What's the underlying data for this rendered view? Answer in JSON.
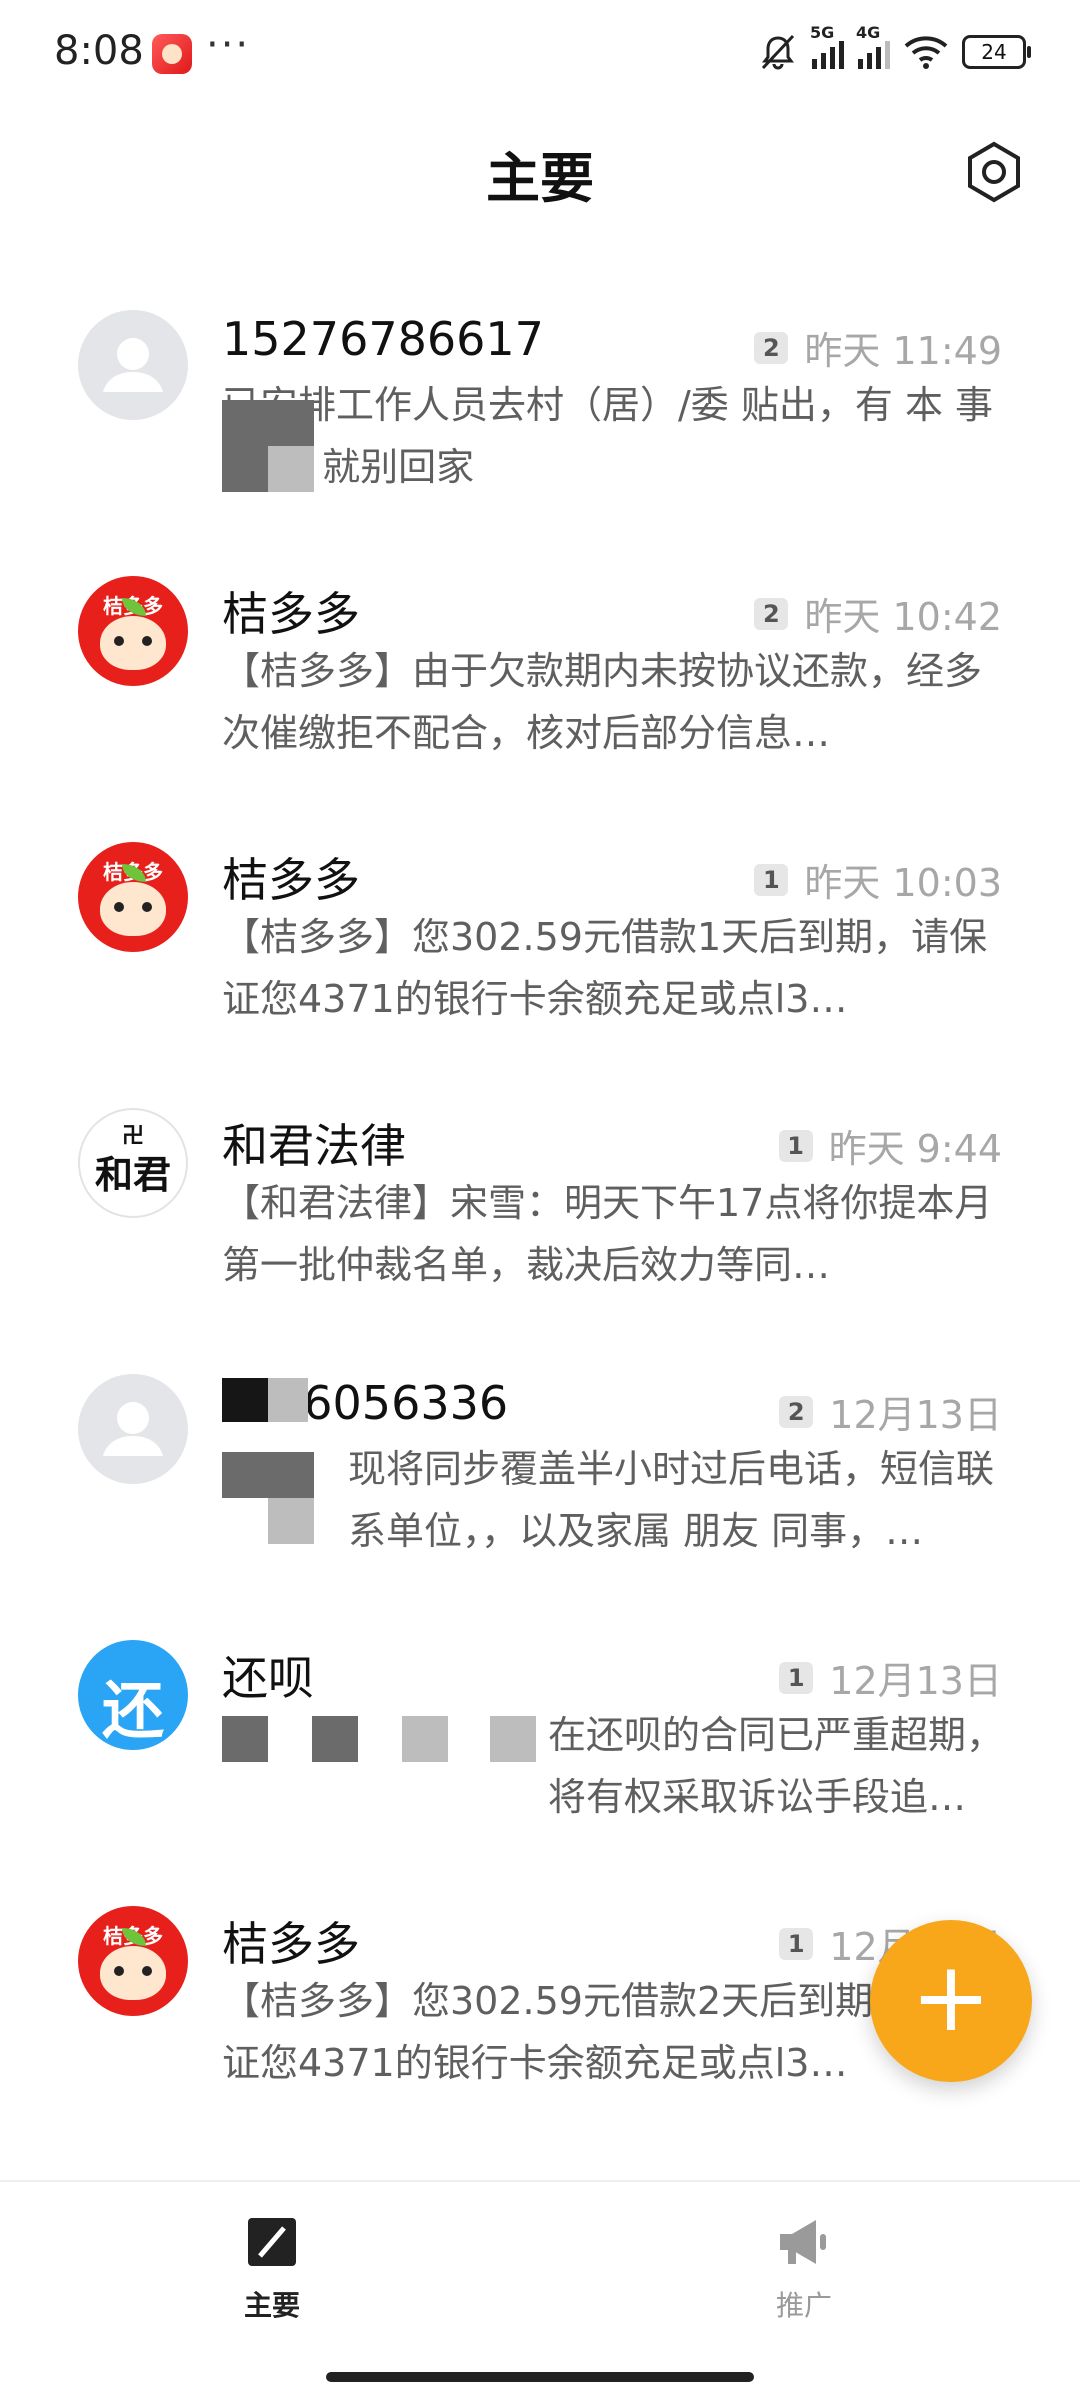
{
  "status_bar": {
    "time": "8:08",
    "dots": "···",
    "net1": "5G",
    "net2": "4G",
    "battery": "24"
  },
  "header": {
    "title": "主要"
  },
  "conversations": [
    {
      "name": "15276786617",
      "badge": "2",
      "time": "昨天 11:49",
      "preview": "已安排工作人员去村（居）/委 贴出，有 本 事 过 年 就别回家",
      "avatar": "person"
    },
    {
      "name": "桔多多",
      "badge": "2",
      "time": "昨天 10:42",
      "preview": "【桔多多】由于欠款期内未按协议还款，经多次催缴拒不配合，核对后部分信息…",
      "avatar": "brand"
    },
    {
      "name": "桔多多",
      "badge": "1",
      "time": "昨天 10:03",
      "preview": "【桔多多】您302.59元借款1天后到期，请保证您4371的银行卡余额充足或点l3…",
      "avatar": "brand"
    },
    {
      "name": "和君法律",
      "badge": "1",
      "time": "昨天 9:44",
      "preview": "【和君法律】宋雪：明天下午17点将你提本月第一批仲裁名单，裁决后效力等同…",
      "avatar": "law"
    },
    {
      "name": "26056336",
      "badge": "2",
      "time": "12月13日",
      "preview": "现将同步覆盖半小时过后电话，短信联系单位，，以及家属 朋友 同事，…",
      "avatar": "person"
    },
    {
      "name": "还呗",
      "badge": "1",
      "time": "12月13日",
      "preview": "在还呗的合同已严重超期，将有权采取诉讼手段追偿欠款…",
      "avatar": "huan"
    },
    {
      "name": "桔多多",
      "badge": "1",
      "time": "12月13日",
      "preview": "【桔多多】您302.59元借款2天后到期，请保证您4371的银行卡余额充足或点l3…",
      "avatar": "brand"
    }
  ],
  "avatar_text": {
    "brand": "桔多多",
    "law_mark": "卍",
    "law": "和君",
    "huan": "还"
  },
  "fab": {
    "label": "+"
  },
  "bottom_nav": [
    {
      "label": "主要",
      "active": true
    },
    {
      "label": "推广",
      "active": false
    }
  ],
  "colors": {
    "accent": "#f8a61a",
    "brand_red": "#e8201c",
    "huan_blue": "#2aa5f5"
  }
}
